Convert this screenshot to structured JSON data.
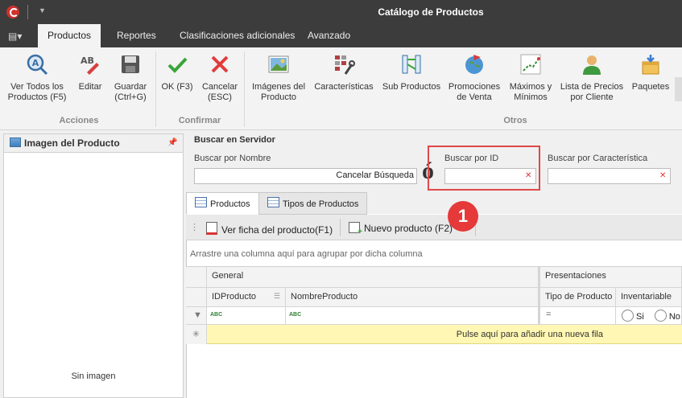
{
  "window": {
    "title": "Catálogo de Productos"
  },
  "ribbon_tabs": [
    "Productos",
    "Reportes",
    "Clasificaciones adicionales",
    "Avanzado"
  ],
  "ribbon": {
    "acciones": {
      "label": "Acciones",
      "buttons": [
        "Ver Todos los\nProductos (F5)",
        "Editar",
        "Guardar\n(Ctrl+G)"
      ]
    },
    "confirmar": {
      "label": "Confirmar",
      "buttons": [
        "OK (F3)",
        "Cancelar\n(ESC)"
      ]
    },
    "otros": {
      "label": "Otros",
      "buttons": [
        "Imágenes del\nProducto",
        "Características",
        "Sub Productos",
        "Promociones\nde Venta",
        "Máximos y\nMínimos",
        "Lista de Precios\npor Cliente",
        "Paquetes"
      ]
    }
  },
  "left_panel": {
    "title": "Imagen del Producto",
    "empty_text": "Sin imagen"
  },
  "search": {
    "title": "Buscar en Servidor",
    "by_name_label": "Buscar por Nombre",
    "cancel_label": "Cancelar Búsqueda",
    "or_text": "ó",
    "by_id_label": "Buscar por ID",
    "by_feature_label": "Buscar por Característica"
  },
  "annotation": {
    "badge": "1"
  },
  "grid_tabs": [
    "Productos",
    "Tipos de Productos"
  ],
  "toolbar": {
    "view_sheet": "Ver ficha del producto(F1)",
    "new_product": "Nuevo producto (F2)"
  },
  "grid": {
    "group_hint": "Arrastre una columna aquí para agrupar por dicha columna",
    "bands": [
      "General",
      "Presentaciones"
    ],
    "columns": [
      "IDProducto",
      "NombreProducto",
      "Tipo de Producto",
      "Inventariable"
    ],
    "filter": {
      "tipo_symbol": "=",
      "radio_yes": "Si",
      "radio_no": "No"
    },
    "new_row_text": "Pulse aquí para añadir una nueva fila"
  },
  "colors": {
    "accent_red": "#e5393a",
    "new_row_bg": "#fff7b3",
    "title_bar": "#3c3c3c"
  }
}
